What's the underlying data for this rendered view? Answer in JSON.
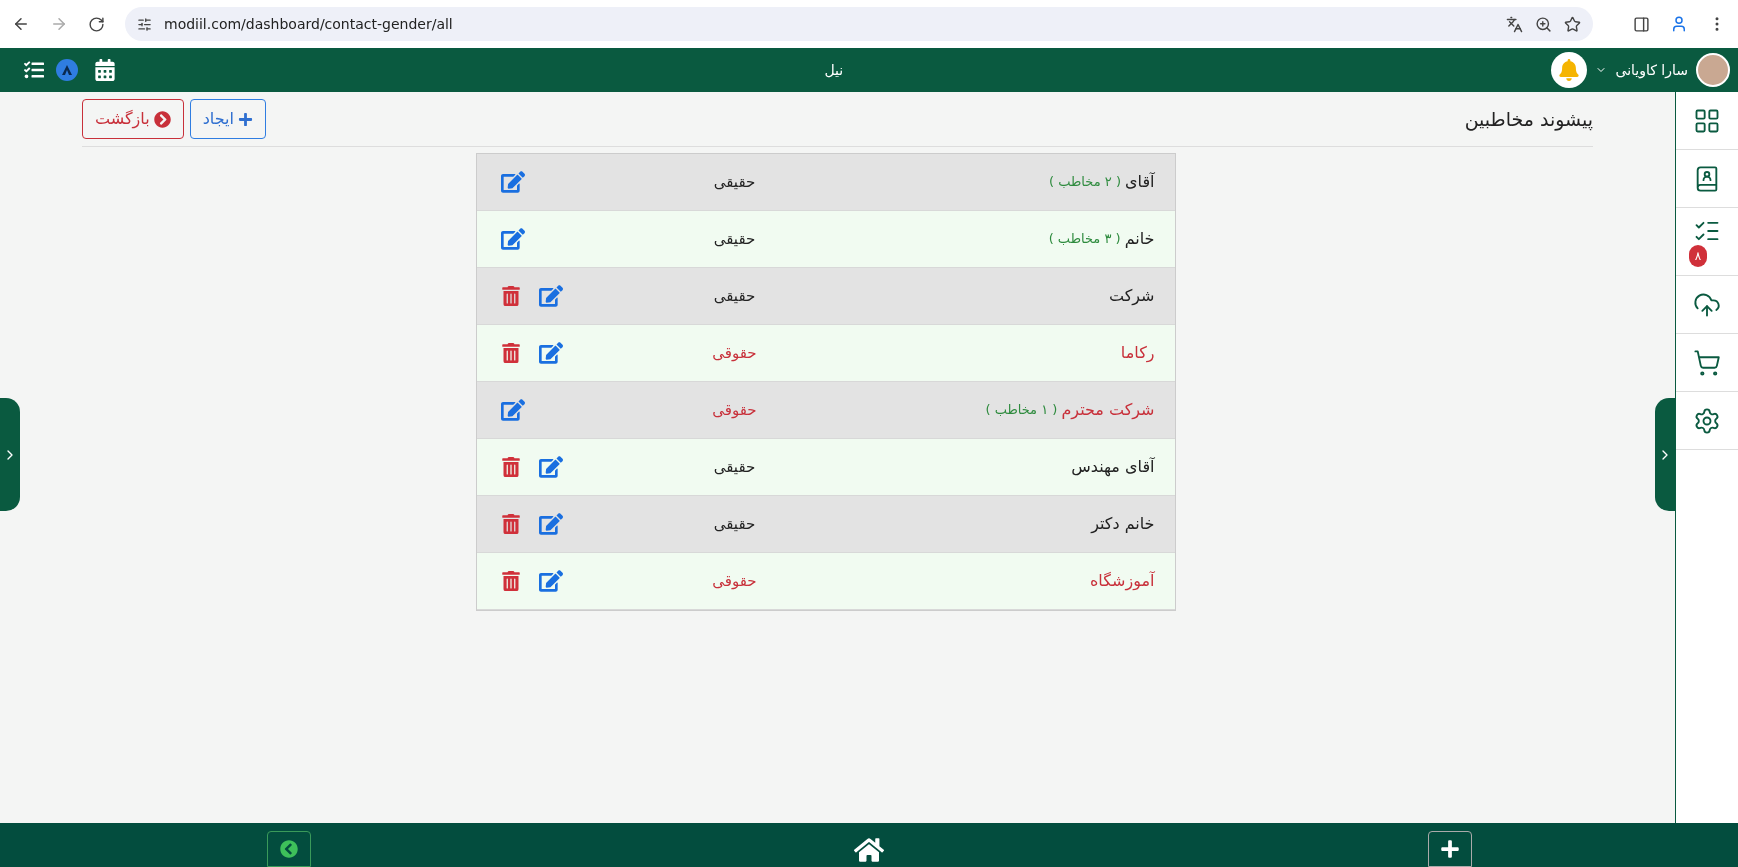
{
  "browser": {
    "url": "modiil.com/dashboard/contact-gender/all"
  },
  "header": {
    "title": "نیل",
    "user_name": "سارا کاویانی"
  },
  "page": {
    "title": "پیشوند مخاطبین",
    "buttons": [
      {
        "kind": "create",
        "label": "ایجاد"
      },
      {
        "kind": "back",
        "label": "بازگشت"
      }
    ]
  },
  "rows": [
    {
      "name": "آقای",
      "count": "( ۲ مخاطب )",
      "type": "حقیقی",
      "kind": "real",
      "deletable": false
    },
    {
      "name": "خانم",
      "count": "( ۳ مخاطب )",
      "type": "حقیقی",
      "kind": "real",
      "deletable": false
    },
    {
      "name": "شرکت",
      "type": "حقیقی",
      "kind": "real",
      "deletable": true
    },
    {
      "name": "رکاما",
      "type": "حقوقی",
      "kind": "legal",
      "deletable": true
    },
    {
      "name": "شرکت محترم",
      "count": "( ۱ مخاطب )",
      "type": "حقوقی",
      "kind": "legal",
      "deletable": false
    },
    {
      "name": "آقای مهندس",
      "type": "حقیقی",
      "kind": "real",
      "deletable": true
    },
    {
      "name": "خانم دکتر",
      "type": "حقیقی",
      "kind": "real",
      "deletable": true
    },
    {
      "name": "آموزشگاه",
      "type": "حقوقی",
      "kind": "legal",
      "deletable": true
    }
  ],
  "sidebar": {
    "items": [
      {
        "kind": "grid"
      },
      {
        "kind": "contacts"
      },
      {
        "kind": "tasks",
        "badge": "۸"
      },
      {
        "kind": "upload"
      },
      {
        "kind": "cart"
      },
      {
        "kind": "settings"
      }
    ]
  }
}
